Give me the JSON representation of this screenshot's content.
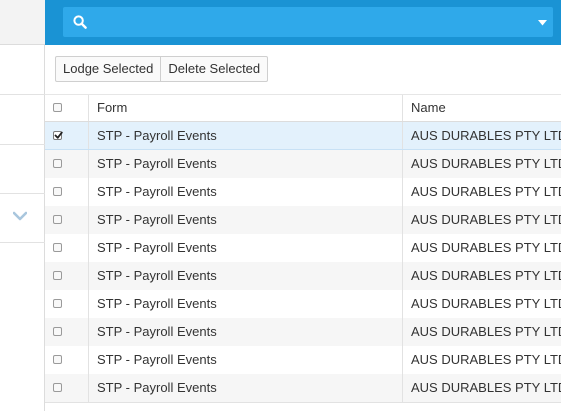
{
  "search": {
    "placeholder": "",
    "value": ""
  },
  "toolbar": {
    "lodge_label": "Lodge Selected",
    "delete_label": "Delete Selected"
  },
  "grid": {
    "columns": {
      "form": "Form",
      "name": "Name"
    },
    "rows": [
      {
        "form": "STP - Payroll Events",
        "name": "AUS DURABLES PTY LTD",
        "checked": true
      },
      {
        "form": "STP - Payroll Events",
        "name": "AUS DURABLES PTY LTD",
        "checked": false
      },
      {
        "form": "STP - Payroll Events",
        "name": "AUS DURABLES PTY LTD",
        "checked": false
      },
      {
        "form": "STP - Payroll Events",
        "name": "AUS DURABLES PTY LTD",
        "checked": false
      },
      {
        "form": "STP - Payroll Events",
        "name": "AUS DURABLES PTY LTD",
        "checked": false
      },
      {
        "form": "STP - Payroll Events",
        "name": "AUS DURABLES PTY LTD",
        "checked": false
      },
      {
        "form": "STP - Payroll Events",
        "name": "AUS DURABLES PTY LTD",
        "checked": false
      },
      {
        "form": "STP - Payroll Events",
        "name": "AUS DURABLES PTY LTD",
        "checked": false
      },
      {
        "form": "STP - Payroll Events",
        "name": "AUS DURABLES PTY LTD",
        "checked": false
      },
      {
        "form": "STP - Payroll Events",
        "name": "AUS DURABLES PTY LTD",
        "checked": false
      }
    ]
  },
  "icons": {
    "search": "search-icon",
    "dropdown": "caret-down-icon",
    "expand": "chevron-down-icon",
    "check": "checkmark-icon"
  },
  "colors": {
    "topbar": "#1a93d4",
    "search_box": "#2fa9ea",
    "selected_row": "#e3f1fc",
    "chevron": "#a9c6dd"
  }
}
